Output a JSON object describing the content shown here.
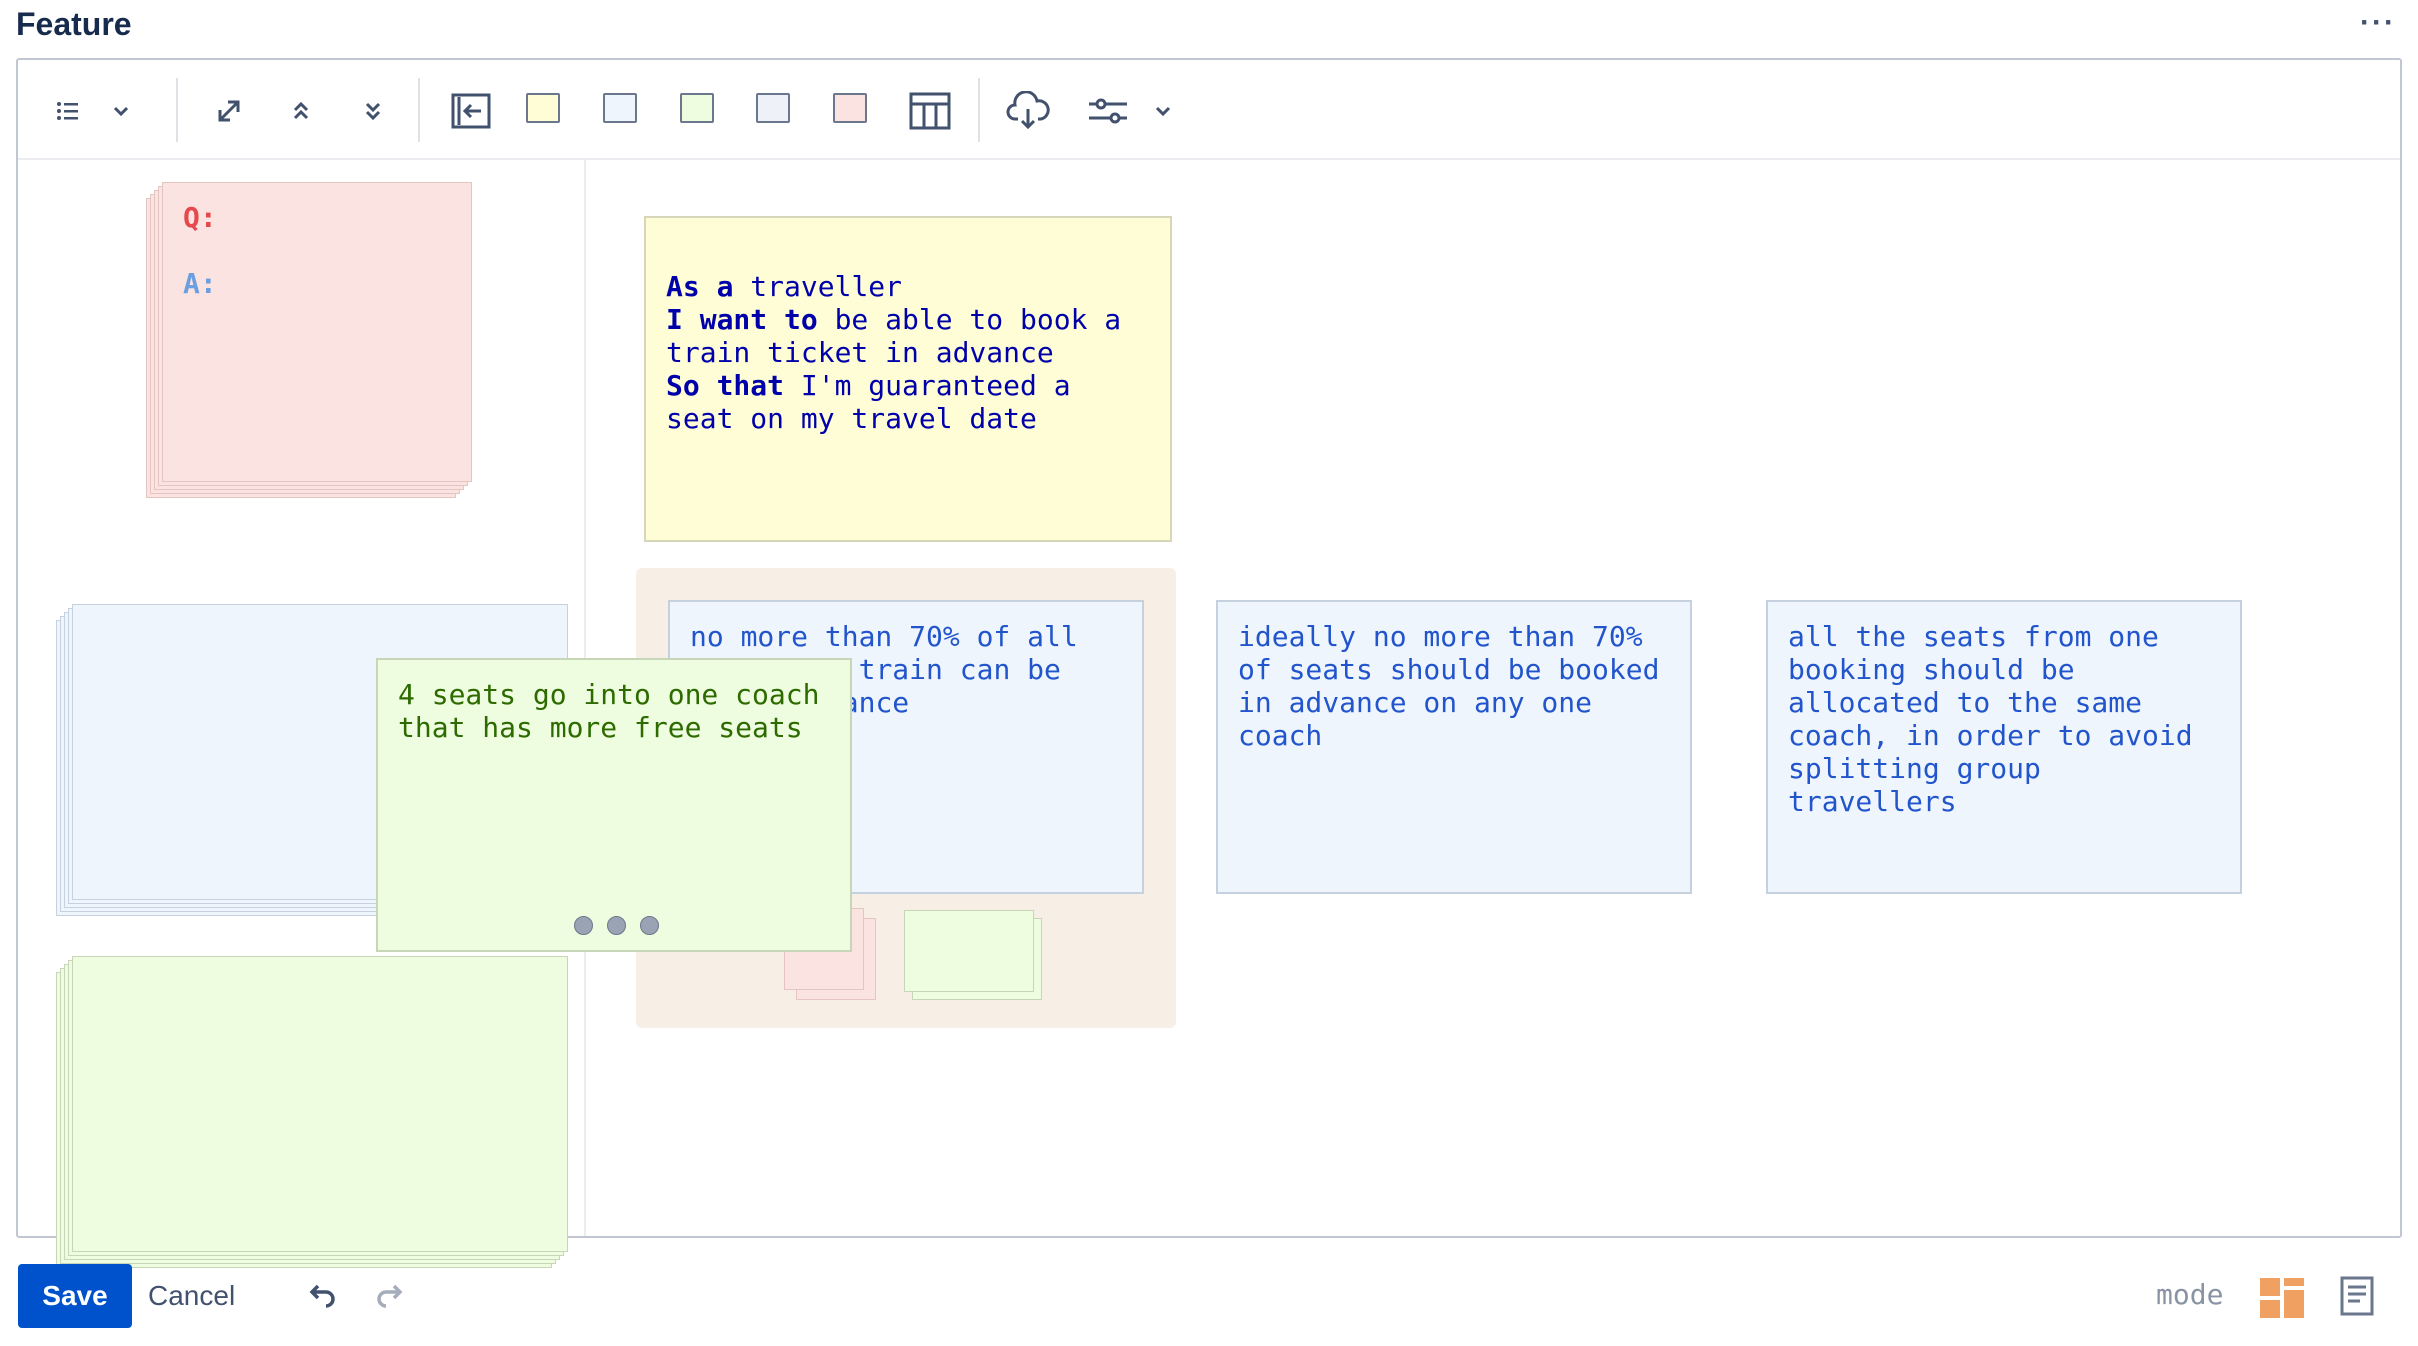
{
  "header": {
    "title": "Feature",
    "more_label": "···"
  },
  "toolbar": {
    "icons": [
      "list-icon",
      "chevron-down-icon",
      "expand-icon",
      "collapse-up-icon",
      "collapse-down-icon",
      "exit-icon",
      "table-icon",
      "cloud-download-icon",
      "sliders-icon",
      "chevron-down-icon"
    ],
    "swatch_colors": [
      "#fefdd6",
      "#eef5fd",
      "#eefcdf",
      "#eef2f8",
      "#fbe3e1"
    ]
  },
  "sidebar": {
    "qa_card": {
      "q_label": "Q:",
      "a_label": "A:"
    }
  },
  "story": {
    "line1_kw": "As a",
    "line1_rest": " traveller",
    "line2_kw": "I want to",
    "line2_rest": " be able to book a\ntrain ticket in advance",
    "line3_kw": "So that",
    "line3_rest": " I'm guaranteed a\nseat on my travel date"
  },
  "rules": [
    "no more than 70% of all\n      the train can be\n      advance",
    "ideally no more than 70%\nof seats should be booked\nin advance on any one\ncoach",
    "all the seats from one\nbooking should be\nallocated to the same\ncoach, in order to avoid\nsplitting group\ntravellers"
  ],
  "dragging_card": {
    "text": "4 seats go into one coach\nthat has more free seats"
  },
  "footer": {
    "save_label": "Save",
    "cancel_label": "Cancel",
    "mode_label": "mode"
  },
  "colors": {
    "accent": "#0052cc",
    "mode_active": "#f0a061"
  }
}
